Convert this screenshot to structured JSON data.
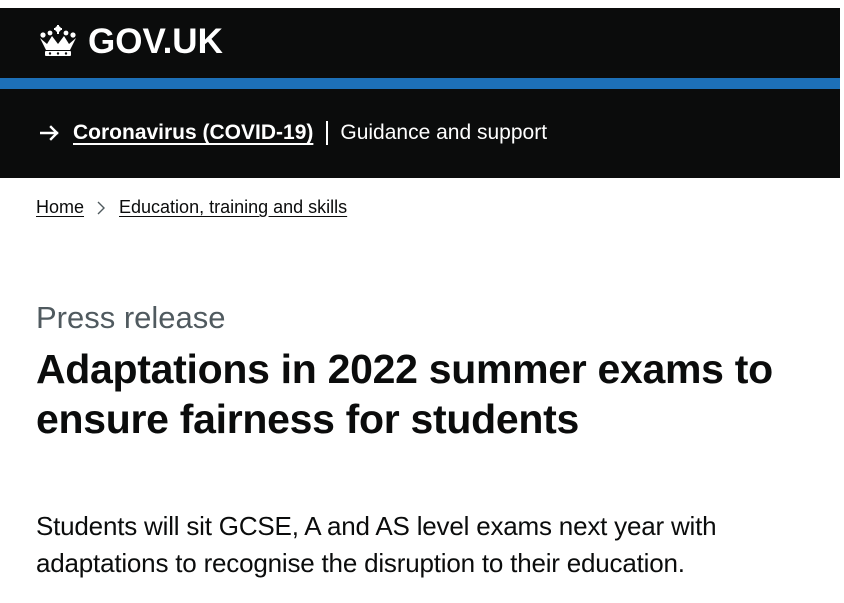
{
  "header": {
    "logo_text": "GOV.UK",
    "logo_icon": "crown-icon"
  },
  "covid_banner": {
    "arrow_icon": "arrow-right-icon",
    "link_label": "Coronavirus (COVID-19)",
    "subtitle": "Guidance and support"
  },
  "breadcrumb": {
    "items": [
      {
        "label": "Home"
      },
      {
        "label": "Education, training and skills"
      }
    ],
    "separator_icon": "chevron-right-icon"
  },
  "article": {
    "caption": "Press release",
    "title": "Adaptations in 2022 summer exams to ensure fairness for students",
    "lead": "Students will sit GCSE, A and AS level exams next year with adaptations to recognise the disruption to their education."
  },
  "colors": {
    "header_bg": "#0b0c0c",
    "accent_blue": "#1d70b8",
    "text": "#0b0c0c",
    "caption_grey": "#505a5f"
  }
}
